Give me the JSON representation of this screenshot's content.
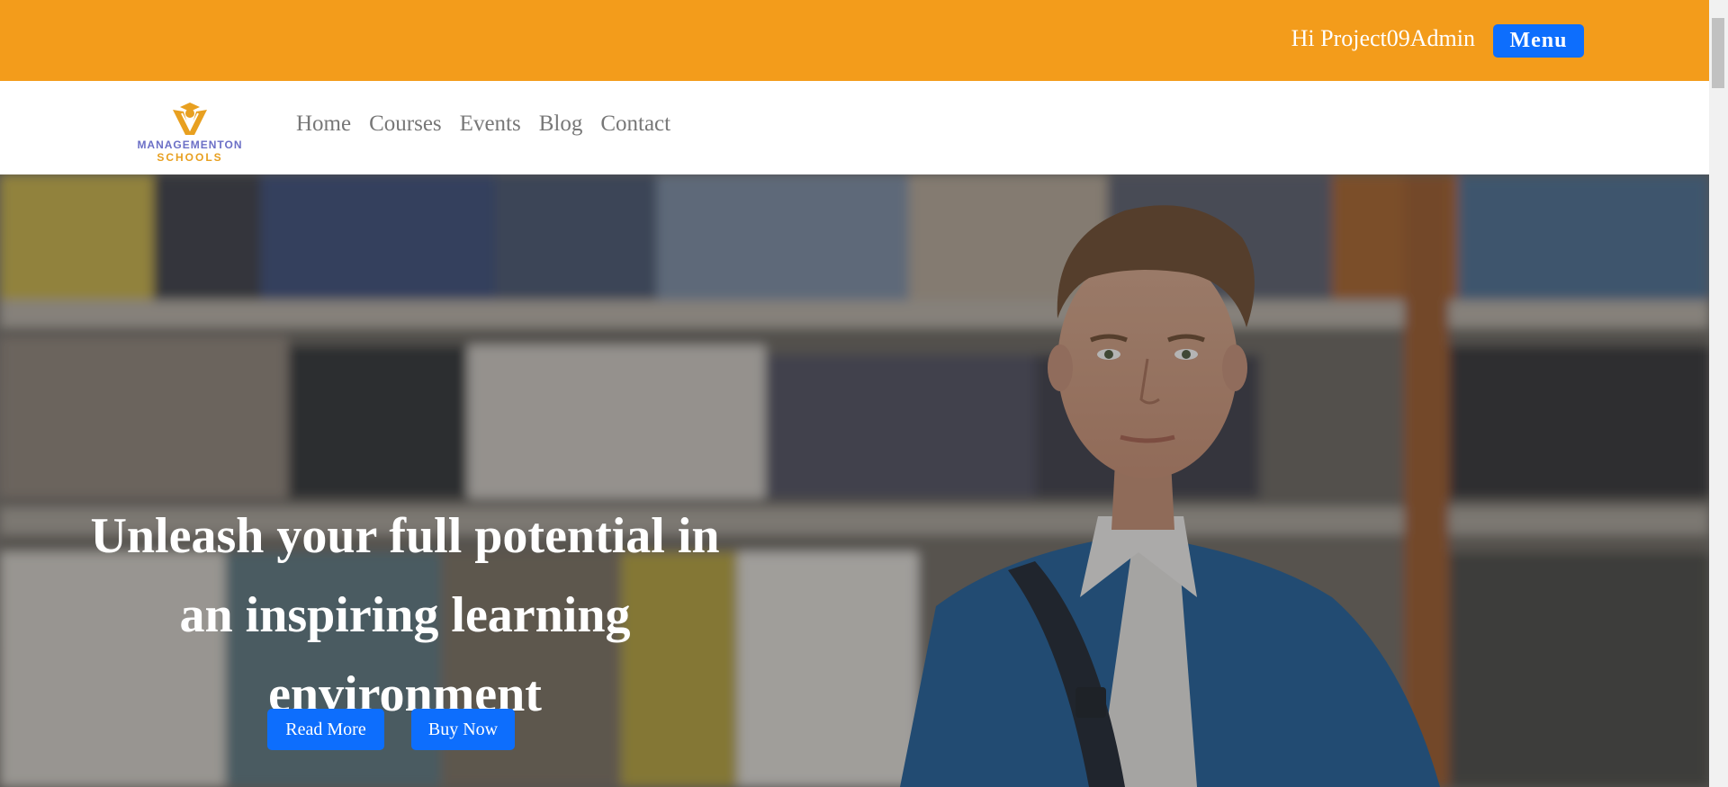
{
  "topbar": {
    "greeting": "Hi Project09Admin",
    "menu_label": "Menu",
    "background_color": "#f39c1b"
  },
  "brand": {
    "line1": "MANAGEMENTON",
    "line2": "SCHOOLS",
    "icon": "graduate-logo-icon"
  },
  "nav": {
    "items": [
      {
        "label": "Home"
      },
      {
        "label": "Courses"
      },
      {
        "label": "Events"
      },
      {
        "label": "Blog"
      },
      {
        "label": "Contact"
      }
    ]
  },
  "hero": {
    "title": "Unleash your full potential in an inspiring learning environment",
    "read_more_label": "Read More",
    "buy_now_label": "Buy Now",
    "button_color": "#0d6efd"
  }
}
